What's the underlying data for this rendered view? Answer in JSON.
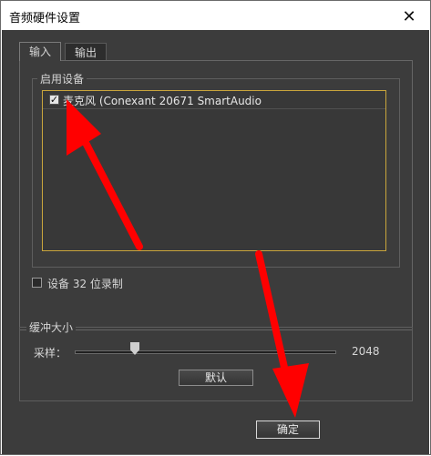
{
  "window": {
    "title": "音频硬件设置"
  },
  "tabs": [
    {
      "label": "输入",
      "active": true
    },
    {
      "label": "输出",
      "active": false
    }
  ],
  "input": {
    "devices_group_title": "启用设备",
    "devices": [
      {
        "label": "麦克风 (Conexant 20671 SmartAudio",
        "checked": true
      }
    ],
    "bit32_label": "设备 32 位录制",
    "bit32_checked": false
  },
  "buffer": {
    "group_title": "缓冲大小",
    "samples_label": "采样：",
    "samples_value": "2048",
    "samples_level": 0.23,
    "default_label": "默认"
  },
  "ok_label": "确定",
  "colors": {
    "background": "#3c3c3c",
    "accent_border": "#c9a53c",
    "annotation_arrow": "#ff0000"
  },
  "icons": {
    "close": "close-icon",
    "checkmark": "checkmark-icon"
  }
}
